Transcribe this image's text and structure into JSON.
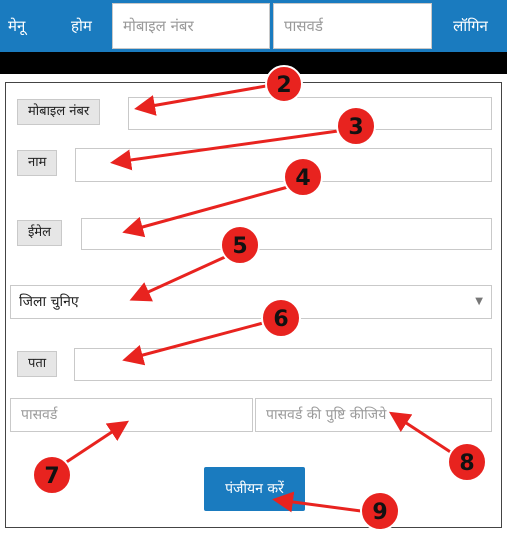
{
  "topbar": {
    "menu_label": "मेनू",
    "home_label": "होम",
    "mobile_placeholder": "मोबाइल नंबर",
    "password_placeholder": "पासवर्ड",
    "login_label": "लॉगिन"
  },
  "form": {
    "mobile_label": "मोबाइल नंबर",
    "name_label": "नाम",
    "email_label": "ईमेल",
    "district_selected": "जिला चुनिए",
    "address_label": "पता",
    "password_placeholder": "पासवर्ड",
    "confirm_password_placeholder": "पासवर्ड की पुष्टि कीजिये",
    "submit_label": "पंजीयन करें"
  },
  "annotations": {
    "step_2": "2",
    "step_3": "3",
    "step_4": "4",
    "step_5": "5",
    "step_6": "6",
    "step_7": "7",
    "step_8": "8",
    "step_9": "9"
  },
  "colors": {
    "brand_blue": "#1a7bbf",
    "annotation_red": "#e8231f",
    "addon_gray": "#e6e6e6"
  }
}
